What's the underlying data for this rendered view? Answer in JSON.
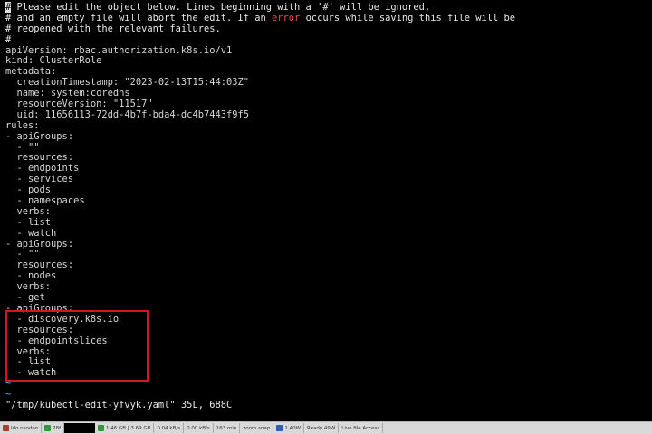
{
  "editor": {
    "comment_lines": [
      "# Please edit the object below. Lines beginning with a '#' will be ignored,",
      "# and an empty file will abort the edit. If an ",
      " occurs while saving this file will be",
      "# reopened with the relevant failures.",
      "#"
    ],
    "error_word": "error",
    "cursor_char": "#",
    "yaml_lines": [
      "apiVersion: rbac.authorization.k8s.io/v1",
      "kind: ClusterRole",
      "metadata:",
      "  creationTimestamp: \"2023-02-13T15:44:03Z\"",
      "  name: system:coredns",
      "  resourceVersion: \"11517\"",
      "  uid: 11656113-72dd-4b7f-bda4-dc4b7443f9f5",
      "rules:",
      "- apiGroups:",
      "  - \"\"",
      "  resources:",
      "  - endpoints",
      "  - services",
      "  - pods",
      "  - namespaces",
      "  verbs:",
      "  - list",
      "  - watch",
      "- apiGroups:",
      "  - \"\"",
      "  resources:",
      "  - nodes",
      "  verbs:",
      "  - get",
      "- apiGroups:",
      "  - discovery.k8s.io",
      "  resources:",
      "  - endpointslices",
      "  verbs:",
      "  - list",
      "  - watch"
    ],
    "tilde_lines": [
      "~",
      "~"
    ],
    "status_line": "\"/tmp/kubectl-edit-yfvyk.yaml\" 35L, 688C"
  },
  "taskbar": {
    "items": [
      "Ido.nsodoo",
      "28f",
      "",
      "1.46 GB | 3.69 GB",
      "0.04 kB/s",
      "0.00 kB/s",
      "163 min",
      "zoom.snap",
      "1.40W",
      "Ready 49W",
      "Live file Access"
    ],
    "colors": {
      "start": "#b23a2a",
      "green": "#2e9a3a",
      "blue": "#2f5fb3"
    }
  }
}
